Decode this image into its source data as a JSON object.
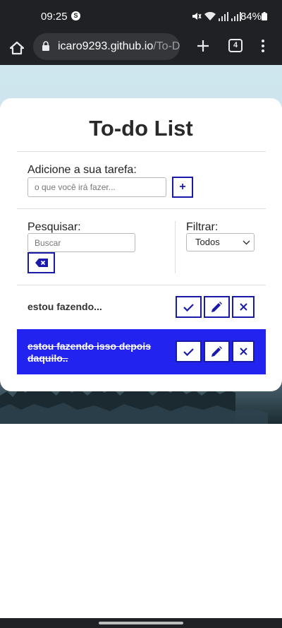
{
  "status_bar": {
    "time": "09:25",
    "app_badge": "S",
    "battery": "84%"
  },
  "browser": {
    "url_host": "icaro9293.github.io",
    "url_path": "/To-D",
    "tab_count": "4"
  },
  "app": {
    "title": "To-do List",
    "add": {
      "label": "Adicione a sua tarefa:",
      "placeholder": "o que você irá fazer...",
      "button": "+"
    },
    "search": {
      "label": "Pesquisar:",
      "placeholder": "Buscar"
    },
    "filter": {
      "label": "Filtrar:",
      "selected": "Todos"
    },
    "todos": [
      {
        "text": "estou fazendo...",
        "done": false
      },
      {
        "text": "estou fazendo isso depois daquilo..",
        "done": true
      }
    ],
    "icons": {
      "complete": "check-icon",
      "edit": "pencil-icon",
      "remove": "x-icon",
      "clear_search": "backspace-icon"
    },
    "colors": {
      "accent": "#1a1aa8",
      "done_bg": "#2323f0"
    }
  }
}
